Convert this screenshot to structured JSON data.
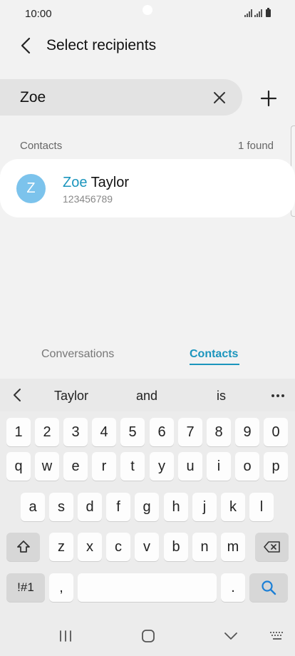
{
  "status": {
    "time": "10:00"
  },
  "header": {
    "title": "Select recipients"
  },
  "search": {
    "value": "Zoe",
    "placeholder": ""
  },
  "contacts": {
    "section_label": "Contacts",
    "found_count": "1 found",
    "items": [
      {
        "initial": "Z",
        "name_match": "Zoe",
        "name_rest": " Taylor",
        "number": "123456789"
      }
    ]
  },
  "tabs": [
    {
      "label": "Conversations",
      "active": false
    },
    {
      "label": "Contacts",
      "active": true
    }
  ],
  "colors": {
    "accent": "#1b95bd",
    "avatar": "#7cc3ec",
    "background": "#f2f2f2"
  },
  "keyboard": {
    "suggestions": [
      "Taylor",
      "and",
      "is"
    ],
    "row1": [
      "1",
      "2",
      "3",
      "4",
      "5",
      "6",
      "7",
      "8",
      "9",
      "0"
    ],
    "row2": [
      "q",
      "w",
      "e",
      "r",
      "t",
      "y",
      "u",
      "i",
      "o",
      "p"
    ],
    "row3": [
      "a",
      "s",
      "d",
      "f",
      "g",
      "h",
      "j",
      "k",
      "l"
    ],
    "row4": [
      "z",
      "x",
      "c",
      "v",
      "b",
      "n",
      "m"
    ],
    "symbols_label": "!#1",
    "comma": ",",
    "period": ".",
    "icons": {
      "shift": "shift-icon",
      "backspace": "backspace-icon",
      "search": "search-icon"
    }
  },
  "nav": {
    "icons": [
      "recent-apps-icon",
      "home-icon",
      "back-icon",
      "keyboard-icon"
    ]
  }
}
